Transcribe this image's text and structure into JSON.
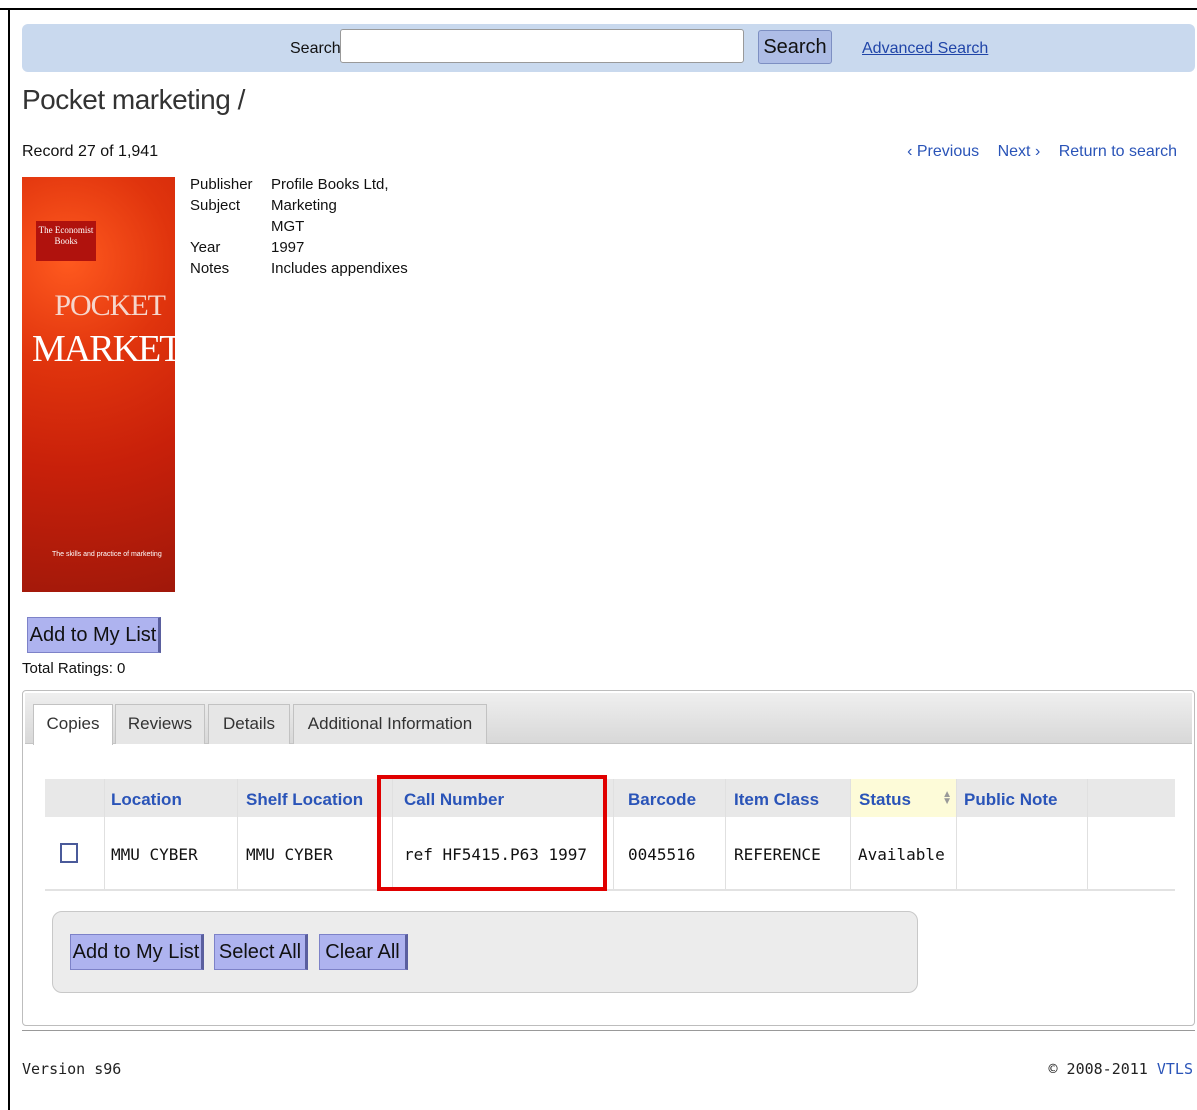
{
  "search": {
    "label": "Search",
    "placeholder": "",
    "value": "",
    "button_label": "Search",
    "advanced_link": "Advanced Search"
  },
  "record": {
    "title": "Pocket marketing /",
    "position_text": "Record 27 of 1,941",
    "nav": {
      "previous": "‹ Previous",
      "next": "Next ›",
      "return": "Return to search"
    }
  },
  "cover": {
    "badge": "The Economist Books",
    "line1": "POCKET",
    "line2": "MARKETING",
    "tagline": "The skills and practice of marketing"
  },
  "metadata": {
    "publisher_label": "Publisher",
    "publisher": "Profile Books Ltd,",
    "subject_label": "Subject",
    "subject_1": "Marketing",
    "subject_2": "MGT",
    "year_label": "Year",
    "year": "1997",
    "notes_label": "Notes",
    "notes": "Includes appendixes"
  },
  "add_to_list_label": "Add to My List",
  "total_ratings": "Total Ratings: 0",
  "tabs": [
    {
      "label": "Copies",
      "active": true
    },
    {
      "label": "Reviews"
    },
    {
      "label": "Details"
    },
    {
      "label": "Additional Information"
    }
  ],
  "copies_table": {
    "headers": [
      "Location",
      "Shelf Location",
      "Call Number",
      "Barcode",
      "Item Class",
      "Status",
      "Public Note"
    ],
    "rows": [
      [
        "MMU CYBER",
        "MMU CYBER",
        "ref HF5415.P63 1997",
        "0045516",
        "REFERENCE",
        "Available",
        ""
      ]
    ]
  },
  "actions": {
    "add_to_list": "Add to My List",
    "select_all": "Select All",
    "clear_all": "Clear All"
  },
  "footer": {
    "version": "Version s96",
    "copyright": "© 2008-2011 ",
    "brand": "VTLS"
  },
  "colors": {
    "link": "#2a54b8",
    "button": "#aeb3ef",
    "search_bar": "#c9d9ee",
    "highlight": "#e00000"
  }
}
